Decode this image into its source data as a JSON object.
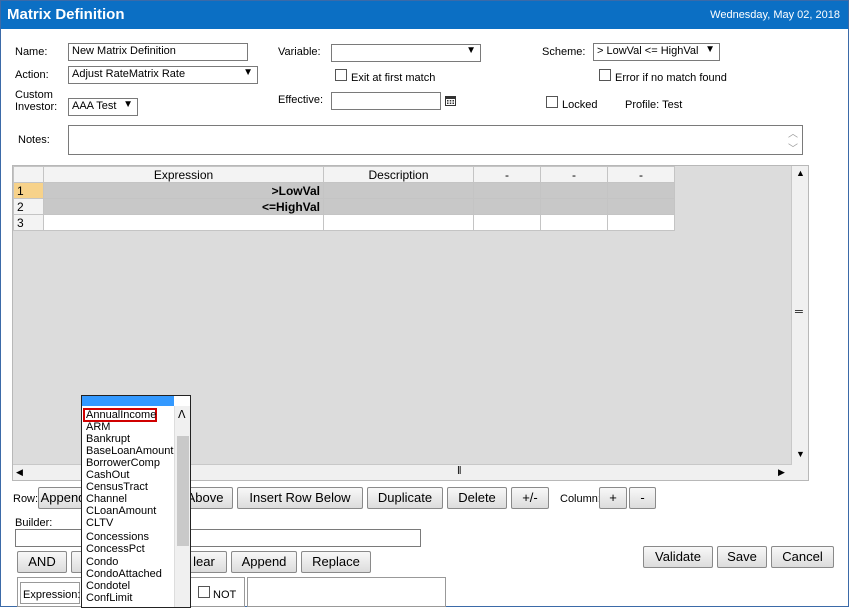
{
  "header": {
    "title": "Matrix Definition",
    "date": "Wednesday, May 02, 2018"
  },
  "form": {
    "name_label": "Name:",
    "name_value": "New Matrix Definition",
    "action_label": "Action:",
    "action_value": "Adjust RateMatrix Rate",
    "custom_investor_label_1": "Custom",
    "custom_investor_label_2": "Investor:",
    "custom_investor_value": "AAA Test",
    "variable_label": "Variable:",
    "variable_value": "",
    "exit_label": "Exit at first match",
    "effective_label": "Effective:",
    "effective_value": "",
    "scheme_label": "Scheme:",
    "scheme_value": "> LowVal <= HighVal",
    "error_label": "Error if no match found",
    "locked_label": "Locked",
    "profile_label": "Profile: Test",
    "notes_label": "Notes:"
  },
  "grid": {
    "columns": [
      "Expression",
      "Description",
      "-",
      "-",
      "-"
    ],
    "rows": [
      {
        "num": "1",
        "expression": ">LowVal"
      },
      {
        "num": "2",
        "expression": "<=HighVal"
      },
      {
        "num": "3",
        "expression": ""
      }
    ]
  },
  "row_bar": {
    "row_label": "Row:",
    "append_label": "Append",
    "insert_above_label": "Above",
    "insert_below_label": "Insert Row Below",
    "duplicate_label": "Duplicate",
    "delete_label": "Delete",
    "toggle_label": "+/-",
    "column_label": "Column:",
    "col_add_label": "+",
    "col_remove_label": "-"
  },
  "builder": {
    "label": "Builder:",
    "value": "",
    "and_label": "AND",
    "clear_label": "lear",
    "append_label": "Append",
    "replace_label": "Replace",
    "expression_label": "Expression:",
    "not_label": "NOT"
  },
  "actions": {
    "validate_label": "Validate",
    "save_label": "Save",
    "cancel_label": "Cancel"
  },
  "dropdown_list": {
    "items": [
      "AnnualIncome",
      "ARM",
      "Bankrupt",
      "BaseLoanAmount",
      "BorrowerComp",
      "CashOut",
      "CensusTract",
      "Channel",
      "CLoanAmount",
      "CLTV",
      "Concessions",
      "ConcessPct",
      "Condo",
      "CondoAttached",
      "Condotel",
      "ConfLimit"
    ],
    "selected": "AnnualIncome"
  },
  "colors": {
    "title_bar": "#0b6fc4",
    "selection_border": "#d00000",
    "row_highlight": "#f7d28a",
    "list_highlight": "#3399ff"
  }
}
